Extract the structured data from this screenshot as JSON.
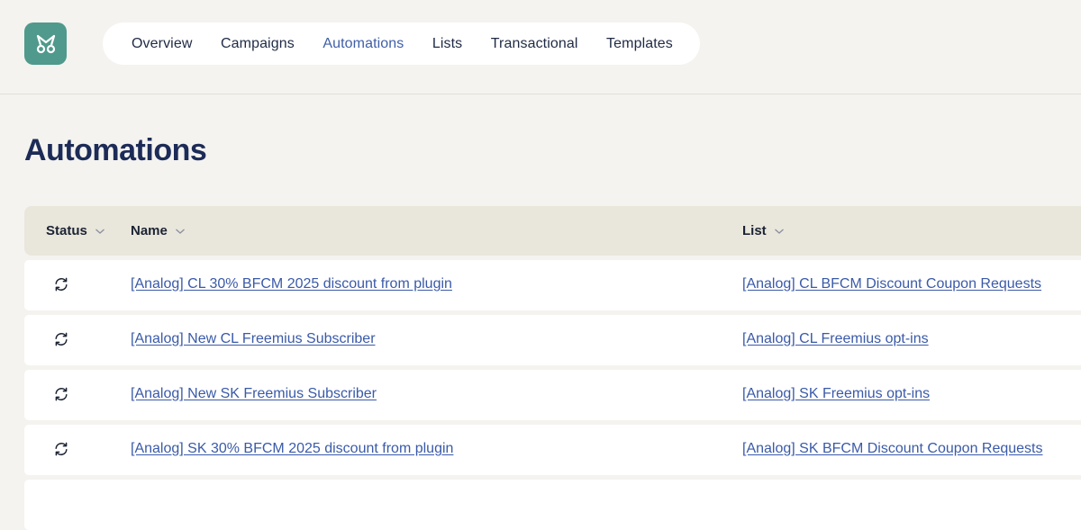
{
  "nav": {
    "items": [
      {
        "label": "Overview"
      },
      {
        "label": "Campaigns"
      },
      {
        "label": "Automations"
      },
      {
        "label": "Lists"
      },
      {
        "label": "Transactional"
      },
      {
        "label": "Templates"
      }
    ],
    "active_label": "Automations"
  },
  "page": {
    "title": "Automations"
  },
  "table": {
    "headers": {
      "status": "Status",
      "name": "Name",
      "list": "List"
    },
    "rows": [
      {
        "status_icon": "sync-icon",
        "name": "[Analog] CL 30% BFCM 2025 discount from plugin",
        "list": "[Analog] CL BFCM Discount Coupon Requests"
      },
      {
        "status_icon": "sync-icon",
        "name": "[Analog] New CL Freemius Subscriber",
        "list": "[Analog] CL Freemius opt-ins"
      },
      {
        "status_icon": "sync-icon",
        "name": "[Analog] New SK Freemius Subscriber",
        "list": "[Analog] SK Freemius opt-ins"
      },
      {
        "status_icon": "sync-icon",
        "name": "[Analog] SK 30% BFCM 2025 discount from plugin",
        "list": "[Analog] SK BFCM Discount Coupon Requests"
      }
    ]
  },
  "colors": {
    "brand": "#4f9a8c",
    "link": "#3a5aa8",
    "title": "#1c2b57",
    "header_bg": "#e9e6dc",
    "page_bg": "#f4f3ef"
  }
}
